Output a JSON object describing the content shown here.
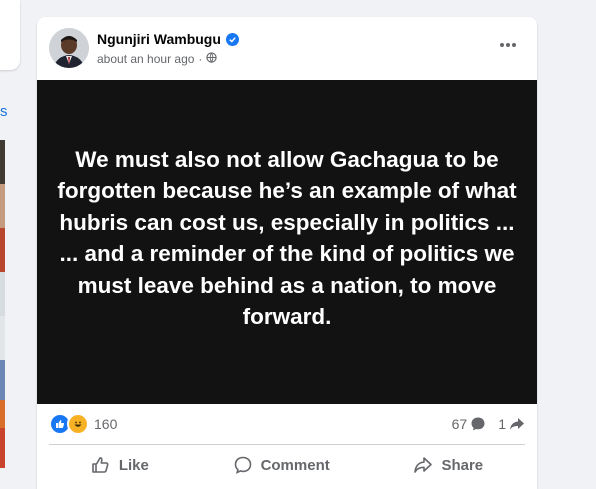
{
  "post": {
    "author_name": "Ngunjiri Wambugu",
    "timestamp": "about an hour ago",
    "privacy_icon": "globe-icon",
    "verified_icon": "verified-badge-icon",
    "more_icon": "more-options-icon",
    "media_text": "We must also not allow Gachagua to be forgotten because he’s an example of what hubris can cost us, especially in politics ...\n... and a reminder of the kind of politics we must leave behind as a nation, to move forward.",
    "reaction_count": "160",
    "comment_count": "67",
    "share_count": "1",
    "actions": {
      "like": "Like",
      "comment": "Comment",
      "share": "Share"
    }
  },
  "left_partial": {
    "link_text": "s"
  },
  "colors": {
    "accent": "#1877f2",
    "media_bg": "#121212",
    "secondary_text": "#65676b"
  }
}
